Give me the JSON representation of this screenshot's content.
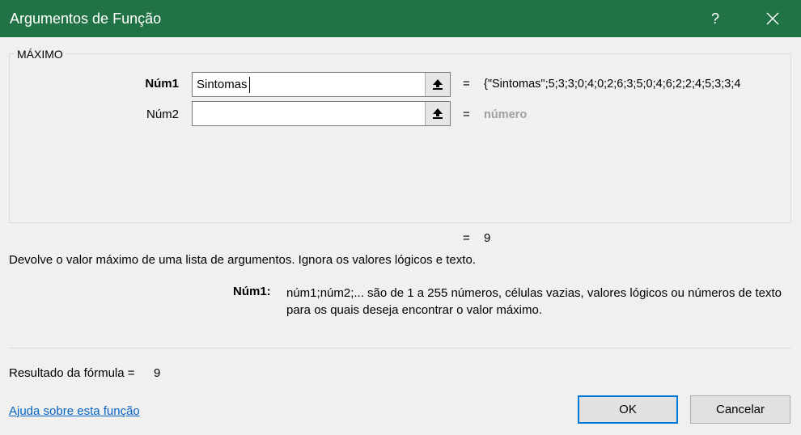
{
  "window": {
    "title": "Argumentos de Função",
    "help_glyph": "?",
    "accent_color": "#217346"
  },
  "function_group": {
    "name": "MÁXIMO",
    "args": [
      {
        "label": "Núm1",
        "input_value": "Sintomas",
        "equals": "=",
        "evaluated": "{\"Sintomas\";5;3;3;0;4;0;2;6;3;5;0;4;6;2;2;4;5;3;3;4"
      },
      {
        "label": "Núm2",
        "input_value": "",
        "equals": "=",
        "evaluated": "número"
      }
    ]
  },
  "function_result": {
    "equals": "=",
    "value": "9"
  },
  "description": "Devolve o valor máximo de uma lista de argumentos. Ignora os valores lógicos e texto.",
  "param_help": {
    "name": "Núm1:",
    "text": "núm1;núm2;... são de 1 a 255 números, células vazias, valores lógicos ou números de texto para os quais deseja encontrar o valor máximo."
  },
  "formula_result": {
    "label": "Resultado da fórmula =",
    "value": "9"
  },
  "footer": {
    "help_link": "Ajuda sobre esta função",
    "ok_label": "OK",
    "cancel_label": "Cancelar"
  }
}
